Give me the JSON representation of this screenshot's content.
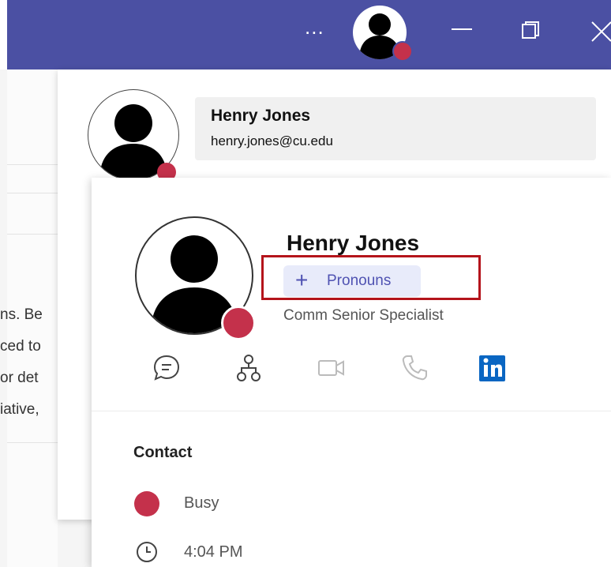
{
  "titlebar": {
    "more_label": "..."
  },
  "background": {
    "lines": [
      "ns. Be",
      "ced to",
      "or det",
      "iative,"
    ]
  },
  "underlying_card": {
    "name": "Henry Jones",
    "email": "henry.jones@cu.edu"
  },
  "profile": {
    "name": "Henry Jones",
    "pronouns_label": "Pronouns",
    "pronouns_plus": "+",
    "job_title": "Comm Senior Specialist",
    "actions": [
      "chat-icon",
      "org-chart-icon",
      "video-call-icon",
      "phone-call-icon",
      "linkedin-icon"
    ]
  },
  "contact": {
    "heading": "Contact",
    "status": "Busy",
    "local_time": "4:04 PM"
  },
  "colors": {
    "brand_bar": "#4b50a3",
    "busy": "#c4314b",
    "highlight": "#b4141b",
    "accent": "#4f52b2"
  }
}
